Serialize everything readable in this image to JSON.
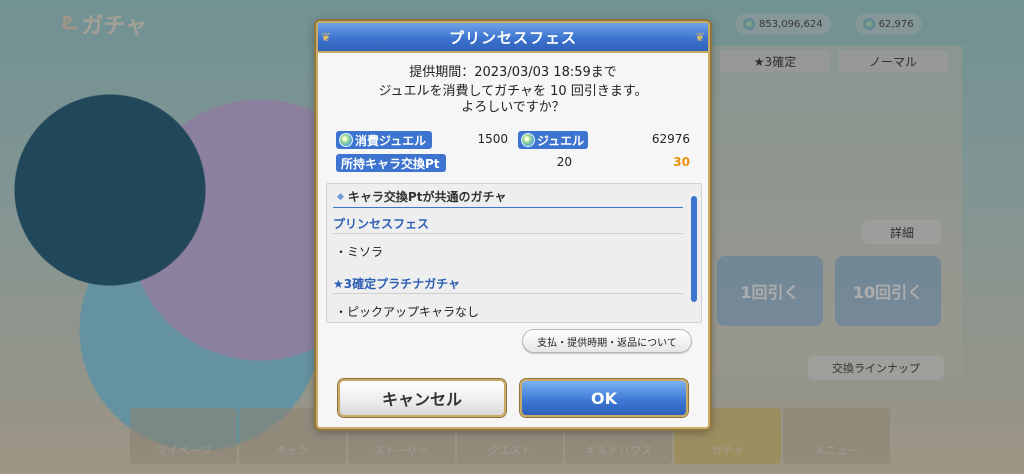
{
  "screen": {
    "title": "ガチャ"
  },
  "currency": {
    "mana": "853,096,624",
    "jewels": "62,976"
  },
  "right_panel": {
    "tabs": [
      "★3確定",
      "ノーマル"
    ],
    "detail_button": "詳細",
    "draw_one": "1回引く",
    "draw_ten": "10回引く",
    "lineup_button": "交換ラインナップ"
  },
  "bottom_nav": [
    "マイページ",
    "キャラ",
    "ストーリー",
    "クエスト",
    "ギルドハウス",
    "ガチャ",
    "メニュー"
  ],
  "dialog": {
    "title": "プリンセスフェス",
    "period": "提供期間：2023/03/03 18:59まで",
    "confirm_line1": "ジュエルを消費してガチャを 10 回引きます。",
    "confirm_line2": "よろしいですか？",
    "cost_label": "消費ジュエル",
    "cost_value": "1500",
    "jewel_label": "ジュエル",
    "jewel_value": "62976",
    "pt_label": "所持キャラ交換Pt",
    "pt_before": "20",
    "pt_after": "30",
    "list_header": "キャラ交換Ptが共通のガチャ",
    "sections": [
      {
        "title": "プリンセスフェス",
        "entry": "・ミソラ"
      },
      {
        "title": "★3確定プラチナガチャ",
        "entry": "・ピックアップキャラなし"
      }
    ],
    "policy_button": "支払・提供時期・返品について",
    "cancel_button": "キャンセル",
    "ok_button": "OK"
  },
  "colors": {
    "header_blue": "#3d74cf",
    "gold_border": "#c9ab67",
    "pt_after_orange": "#e8920e",
    "section_blue": "#2c5fb5"
  }
}
